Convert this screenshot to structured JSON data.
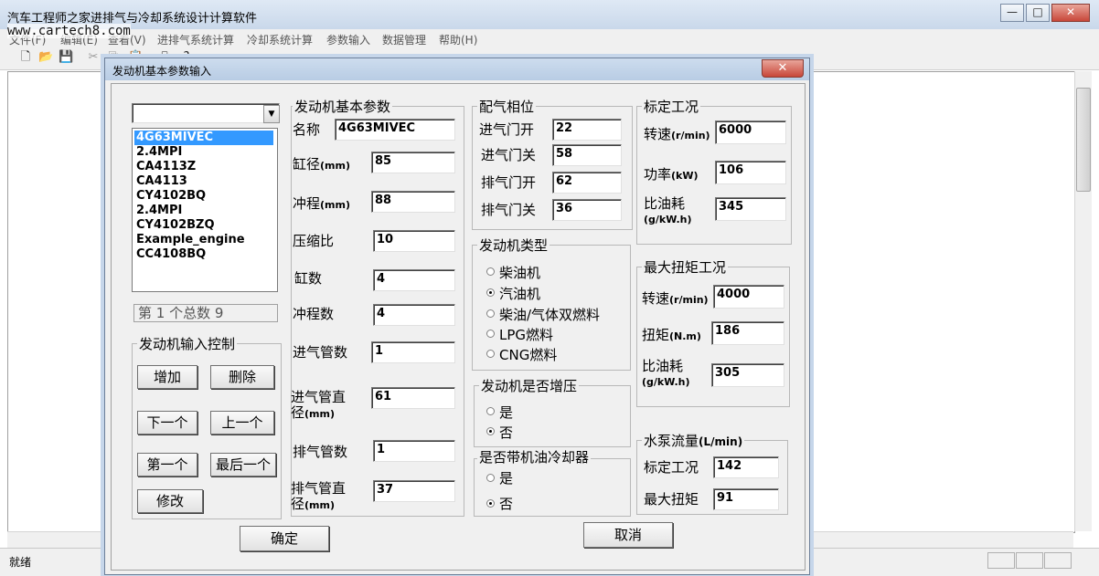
{
  "app": {
    "title": "汽车工程师之家进排气与冷却系统设计计算软件",
    "watermark": "www.cartech8.com",
    "menu": [
      "文件(F)",
      "编辑(E)",
      "查看(V)",
      "进排气系统计算",
      "冷却系统计算",
      "参数输入",
      "数据管理",
      "帮助(H)"
    ],
    "window_buttons": [
      "—",
      "□",
      "✕"
    ],
    "status": "就绪"
  },
  "dialog": {
    "title": "发动机基本参数输入",
    "close": "✕",
    "engine_combo": "",
    "engine_list": [
      "4G63MIVEC",
      "2.4MPI",
      "CA4113Z",
      "CA4113",
      "CY4102BQ",
      "2.4MPI",
      "CY4102BZQ",
      "Example_engine",
      "CC4108BQ"
    ],
    "selected_index": 0,
    "record_info": "第 1 个总数 9",
    "input_control": {
      "label": "发动机输入控制",
      "add": "增加",
      "delete": "删除",
      "next": "下一个",
      "prev": "上一个",
      "first": "第一个",
      "last": "最后一个",
      "modify": "修改"
    },
    "basic": {
      "label": "发动机基本参数",
      "name_label": "名称",
      "name": "4G63MIVEC",
      "bore_label": "缸径",
      "bore_unit": "(mm)",
      "bore": "85",
      "stroke_label": "冲程",
      "stroke_unit": "(mm)",
      "stroke": "88",
      "cr_label": "压缩比",
      "cr": "10",
      "cyl_label": "缸数",
      "cyl": "4",
      "strokes_label": "冲程数",
      "strokes": "4",
      "intake_count_label": "进气管数",
      "intake_count": "1",
      "intake_dia_label1": "进气管直",
      "intake_dia_label2": "径",
      "intake_dia_unit": "(mm)",
      "intake_dia": "61",
      "exhaust_count_label": "排气管数",
      "exhaust_count": "1",
      "exhaust_dia_label1": "排气管直",
      "exhaust_dia_label2": "径",
      "exhaust_dia_unit": "(mm)",
      "exhaust_dia": "37"
    },
    "valve_timing": {
      "label": "配气相位",
      "ivo_label": "进气门开",
      "ivo": "22",
      "ivc_label": "进气门关",
      "ivc": "58",
      "evo_label": "排气门开",
      "evo": "62",
      "evc_label": "排气门关",
      "evc": "36"
    },
    "engine_type": {
      "label": "发动机类型",
      "options": [
        "柴油机",
        "汽油机",
        "柴油/气体双燃料",
        "LPG燃料",
        "CNG燃料"
      ],
      "selected": 1
    },
    "turbo": {
      "label": "发动机是否增压",
      "yes": "是",
      "no": "否",
      "selected": "no"
    },
    "oil_cooler": {
      "label": "是否带机油冷却器",
      "yes": "是",
      "no": "否",
      "selected": "no"
    },
    "rated": {
      "label": "标定工况",
      "speed_label": "转速",
      "speed_unit": "(r/min)",
      "speed": "6000",
      "power_label": "功率",
      "power_unit": "(kW)",
      "power": "106",
      "bsfc_label": "比油耗",
      "bsfc_unit": "(g/kW.h)",
      "bsfc": "345"
    },
    "max_torque": {
      "label": "最大扭矩工况",
      "speed_label": "转速",
      "speed_unit": "(r/min)",
      "speed": "4000",
      "torque_label": "扭矩",
      "torque_unit": "(N.m)",
      "torque": "186",
      "bsfc_label": "比油耗",
      "bsfc_unit": "(g/kW.h)",
      "bsfc": "305"
    },
    "pump": {
      "label": "水泵流量",
      "label_unit": "(L/min)",
      "rated_label": "标定工况",
      "rated": "142",
      "max_label": "最大扭矩",
      "max": "91"
    },
    "ok": "确定",
    "cancel": "取消"
  }
}
